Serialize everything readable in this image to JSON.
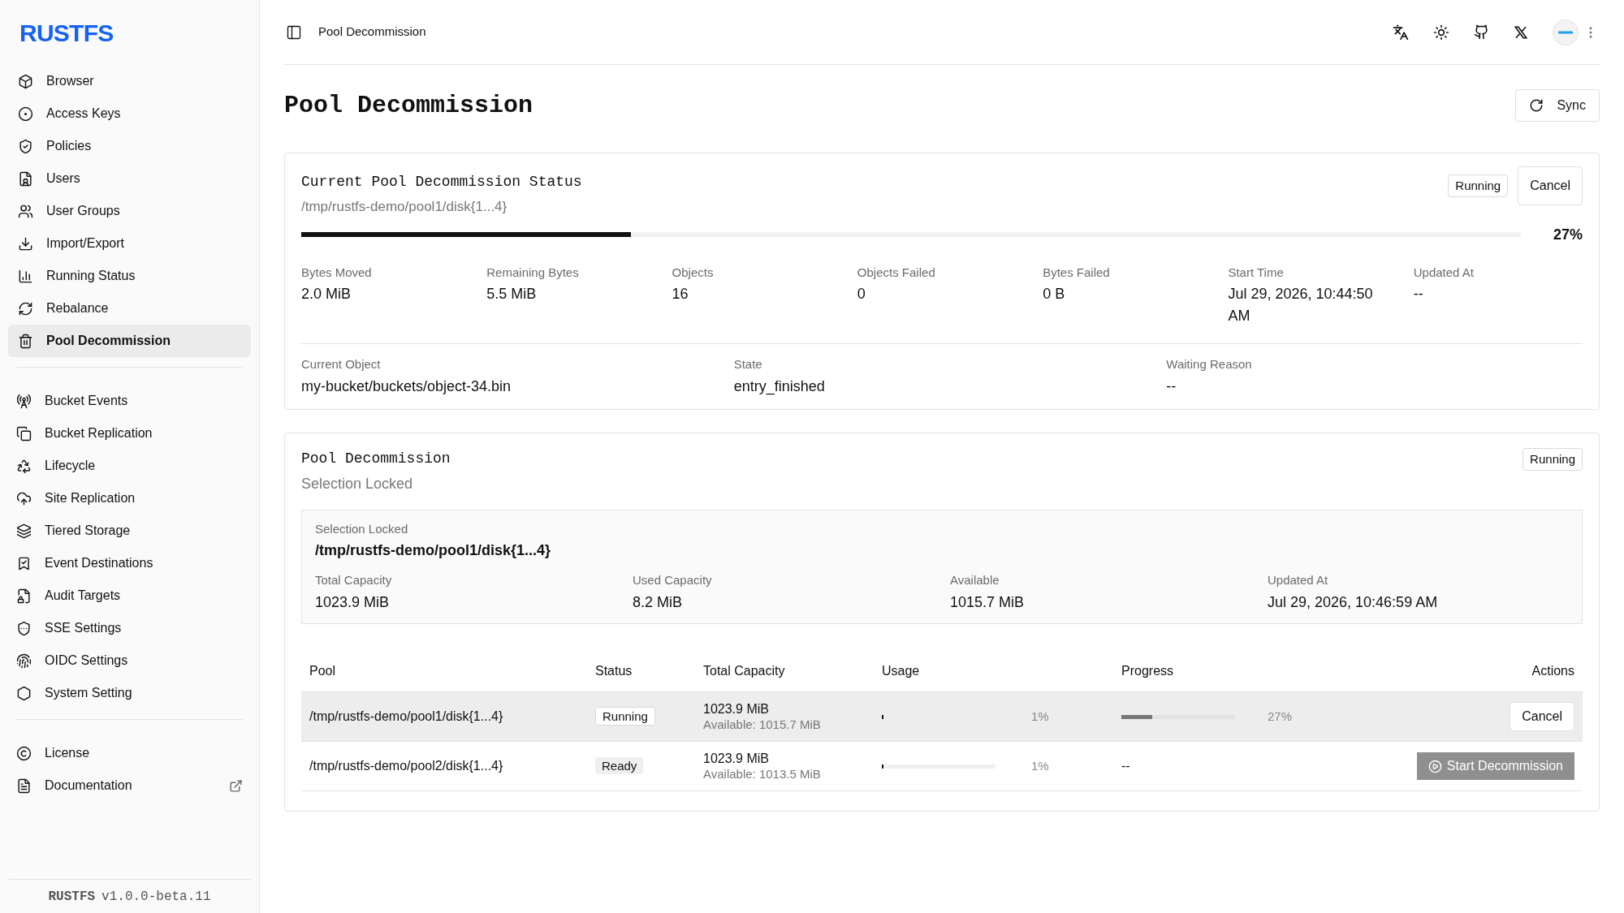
{
  "sidebar": {
    "logo": "RUSTFS",
    "groups": [
      {
        "items": [
          {
            "label": "Browser",
            "selected": false
          },
          {
            "label": "Access Keys",
            "selected": false
          },
          {
            "label": "Policies",
            "selected": false
          },
          {
            "label": "Users",
            "selected": false
          },
          {
            "label": "User Groups",
            "selected": false
          },
          {
            "label": "Import/Export",
            "selected": false
          },
          {
            "label": "Running Status",
            "selected": false
          },
          {
            "label": "Rebalance",
            "selected": false
          },
          {
            "label": "Pool Decommission",
            "selected": true
          }
        ]
      },
      {
        "items": [
          {
            "label": "Bucket Events",
            "selected": false
          },
          {
            "label": "Bucket Replication",
            "selected": false
          },
          {
            "label": "Lifecycle",
            "selected": false
          },
          {
            "label": "Site Replication",
            "selected": false
          },
          {
            "label": "Tiered Storage",
            "selected": false
          },
          {
            "label": "Event Destinations",
            "selected": false
          },
          {
            "label": "Audit Targets",
            "selected": false
          },
          {
            "label": "SSE Settings",
            "selected": false
          },
          {
            "label": "OIDC Settings",
            "selected": false
          },
          {
            "label": "System Setting",
            "selected": false
          }
        ]
      },
      {
        "items": [
          {
            "label": "License",
            "selected": false,
            "external": false
          },
          {
            "label": "Documentation",
            "selected": false,
            "external": true
          }
        ]
      }
    ],
    "footer": {
      "product": "RUSTFS",
      "version": "v1.0.0-beta.11"
    }
  },
  "topbar": {
    "breadcrumb": "Pool Decommission"
  },
  "page": {
    "title": "Pool Decommission",
    "sync_button": "Sync"
  },
  "status_card": {
    "title": "Current Pool Decommission Status",
    "pool": "/tmp/rustfs-demo/pool1/disk{1...4}",
    "badge": "Running",
    "cancel_button": "Cancel",
    "level": 0.27,
    "percent": "27%",
    "stats": [
      {
        "label": "Bytes Moved",
        "value": "2.0 MiB"
      },
      {
        "label": "Remaining Bytes",
        "value": "5.5 MiB"
      },
      {
        "label": "Objects",
        "value": "16"
      },
      {
        "label": "Objects Failed",
        "value": "0"
      },
      {
        "label": "Bytes Failed",
        "value": "0 B"
      },
      {
        "label": "Start Time",
        "value": "Jul 29, 2026, 10:44:50 AM"
      },
      {
        "label": "Updated At",
        "value": "--"
      }
    ],
    "details": [
      {
        "label": "Current Object",
        "value": "my-bucket/buckets/object-34.bin"
      },
      {
        "label": "State",
        "value": "entry_finished"
      },
      {
        "label": "Waiting Reason",
        "value": "--"
      }
    ]
  },
  "pool_card": {
    "title": "Pool Decommission",
    "subtitle": "Selection Locked",
    "badge": "Running",
    "locked": {
      "label": "Selection Locked",
      "pool": "/tmp/rustfs-demo/pool1/disk{1...4}",
      "stats": [
        {
          "label": "Total Capacity",
          "value": "1023.9 MiB"
        },
        {
          "label": "Used Capacity",
          "value": "8.2 MiB"
        },
        {
          "label": "Available",
          "value": "1015.7 MiB"
        },
        {
          "label": "Updated At",
          "value": "Jul 29, 2026, 10:46:59 AM"
        }
      ]
    },
    "table": {
      "columns": [
        "Pool",
        "Status",
        "Total Capacity",
        "Usage",
        "Progress",
        "Actions"
      ],
      "rows": [
        {
          "pool": "/tmp/rustfs-demo/pool1/disk{1...4}",
          "status": {
            "label": "Running",
            "kind": "running"
          },
          "selected": true,
          "total": "1023.9 MiB",
          "available": "Available: 1015.7 MiB",
          "usage": {
            "level": 0.01,
            "percent": "1%"
          },
          "progress": {
            "kind": "bar",
            "level": 0.27,
            "percent": "27%"
          },
          "action": {
            "kind": "cancel",
            "label": "Cancel",
            "disabled": false
          }
        },
        {
          "pool": "/tmp/rustfs-demo/pool2/disk{1...4}",
          "status": {
            "label": "Ready",
            "kind": "ready"
          },
          "selected": false,
          "total": "1023.9 MiB",
          "available": "Available: 1013.5 MiB",
          "usage": {
            "level": 0.01,
            "percent": "1%"
          },
          "progress": {
            "kind": "none",
            "text": "--"
          },
          "action": {
            "kind": "start",
            "label": "Start Decommission",
            "disabled": true
          }
        }
      ]
    }
  }
}
